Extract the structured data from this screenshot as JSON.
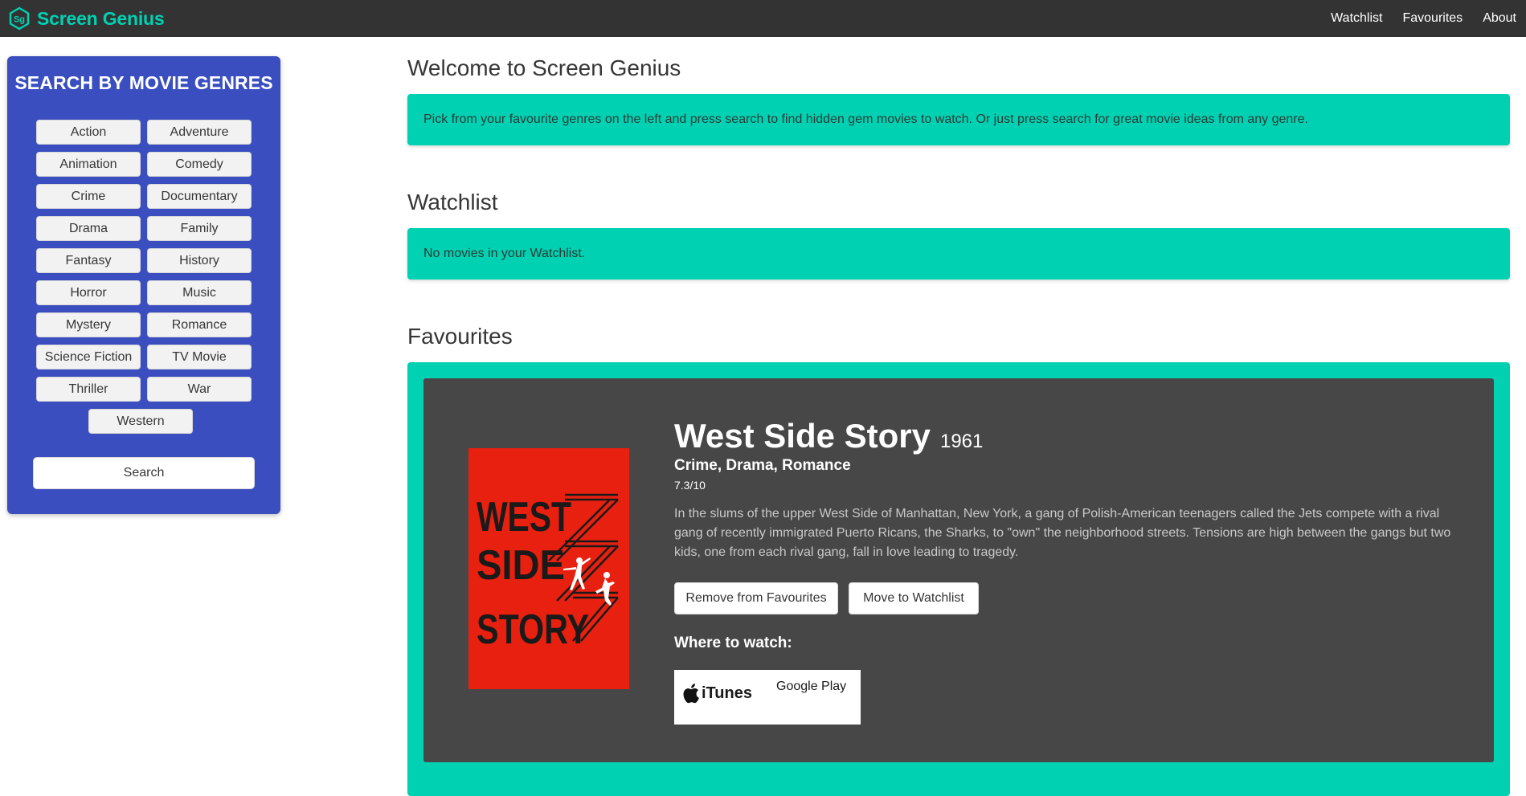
{
  "navbar": {
    "brand_name": "Screen Genius",
    "logo_text": "Sg",
    "links": [
      "Watchlist",
      "Favourites",
      "About"
    ]
  },
  "sidebar": {
    "title": "SEARCH BY MOVIE GENRES",
    "genres": [
      "Action",
      "Adventure",
      "Animation",
      "Comedy",
      "Crime",
      "Documentary",
      "Drama",
      "Family",
      "Fantasy",
      "History",
      "Horror",
      "Music",
      "Mystery",
      "Romance",
      "Science Fiction",
      "TV Movie",
      "Thriller",
      "War",
      "Western"
    ],
    "search_label": "Search"
  },
  "welcome": {
    "title": "Welcome to Screen Genius",
    "message": "Pick from your favourite genres on the left and press search to find hidden gem movies to watch. Or just press search for great movie ideas from any genre."
  },
  "watchlist": {
    "title": "Watchlist",
    "message": "No movies in your Watchlist."
  },
  "favourites": {
    "title": "Favourites",
    "movie": {
      "title": "West Side Story",
      "year": "1961",
      "genres": "Crime, Drama, Romance",
      "rating": "7.3/10",
      "overview": "In the slums of the upper West Side of Manhattan, New York, a gang of Polish-American teenagers called the Jets compete with a rival gang of recently immigrated Puerto Ricans, the Sharks, to \"own\" the neighborhood streets. Tensions are high between the gangs but two kids, one from each rival gang, fall in love leading to tragedy.",
      "poster_lines": [
        "WEST",
        "SIDE",
        "STORY"
      ],
      "remove_label": "Remove from Favourites",
      "move_label": "Move to Watchlist",
      "where_label": "Where to watch:",
      "providers": [
        {
          "name": "iTunes",
          "icon": "apple-icon"
        },
        {
          "name": "Google Play",
          "icon": ""
        }
      ]
    }
  },
  "colors": {
    "navbar": "#333333",
    "brand": "#00d1b2",
    "sidebar": "#3a4ec0",
    "accent": "#00d1b2",
    "card": "#474747",
    "poster": "#e8200f"
  }
}
